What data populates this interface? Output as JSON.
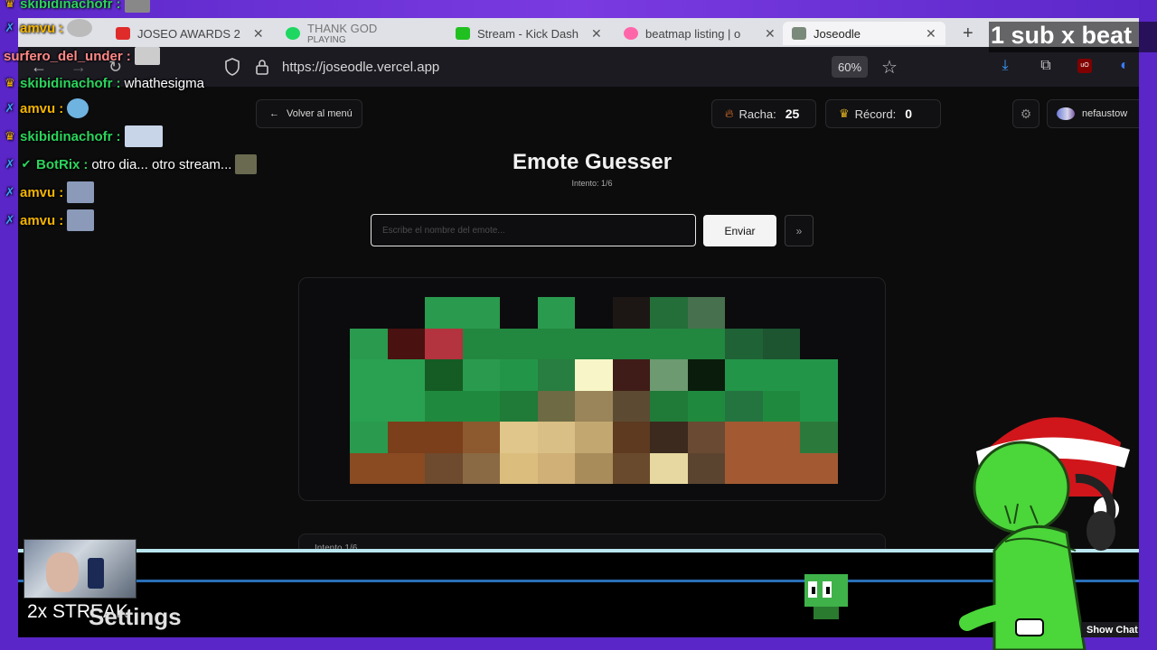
{
  "tabs": [
    {
      "title": "JOSEO AWARDS 2",
      "favicon_color": "#e02b2b",
      "has_close": true
    },
    {
      "title": "THANK GOD",
      "subtitle": "PLAYING",
      "favicon_color": "#1ed760",
      "has_close": false
    },
    {
      "title": "Stream - Kick Dash",
      "favicon_color": "#21c021",
      "has_close": true
    },
    {
      "title": "beatmap listing | o",
      "favicon_color": "#ff66aa",
      "has_close": true
    },
    {
      "title": "Joseodle",
      "favicon_color": "#7a8a7a",
      "has_close": true,
      "active": true
    }
  ],
  "new_tab_label": "+",
  "address": {
    "url": "https://joseodle.vercel.app",
    "zoom": "60%"
  },
  "toolbar_icons": [
    "download-icon",
    "extensions-icon",
    "ublock-icon",
    "profile-icon"
  ],
  "app": {
    "back_label": "Volver al menú",
    "streak_label": "Racha:",
    "streak_value": "25",
    "record_label": "Récord:",
    "record_value": "0",
    "username": "nefaustow",
    "title": "Emote Guesser",
    "attempt_text": "Intento: 1/6",
    "input_placeholder": "Escribe el nombre del emote...",
    "input_value": "",
    "send_label": "Enviar",
    "skip_label": "»",
    "history_label": "Intento 1/6"
  },
  "pixel_colors": [
    [
      "#0c0c0e",
      "#0c0c0e",
      "#2a9a4e",
      "#2a9a4e",
      "#0c0c0e",
      "#2a9a4e",
      "#0c0c0e",
      "#1c1715",
      "#246e3a",
      "#47704e",
      "#0c0c0e",
      "#0c0c0e",
      "#0c0c0e"
    ],
    [
      "#2a9a4e",
      "#4a1111",
      "#b3333e",
      "#22873f",
      "#22873f",
      "#22873f",
      "#22873f",
      "#22873f",
      "#22873f",
      "#22873f",
      "#1f6236",
      "#1c5530",
      "#0c0c0e"
    ],
    [
      "#2aa150",
      "#2aa150",
      "#145c23",
      "#2a9a4e",
      "#239548",
      "#277e40",
      "#f8f6c8",
      "#3f1c17",
      "#6d9a70",
      "#0a1c0c",
      "#239548",
      "#239548",
      "#239548"
    ],
    [
      "#2aa150",
      "#2aa150",
      "#1f8a3e",
      "#1f8a3e",
      "#207a38",
      "#6d6a44",
      "#9a845a",
      "#5d4a33",
      "#207a38",
      "#1f8a3e",
      "#247440",
      "#1f8a3e",
      "#239548"
    ],
    [
      "#2a9a4e",
      "#7b3f1b",
      "#7b3f1b",
      "#8c5a2e",
      "#e0c68a",
      "#d9bf85",
      "#c2a870",
      "#5d3a20",
      "#3b2a1d",
      "#6a4a33",
      "#a35a32",
      "#a35a32",
      "#2b7a3c"
    ],
    [
      "#8a4a22",
      "#8a4a22",
      "#6e4a2e",
      "#8a6a44",
      "#dbbe7e",
      "#d0b077",
      "#a88c5a",
      "#6a4a2c",
      "#e6d8a0",
      "#5a4430",
      "#a35a32",
      "#a35a32",
      "#a35a32"
    ]
  ],
  "chat": [
    {
      "badge": "crown",
      "user": "skibidinachofr",
      "color": "#2bd45c",
      "message": ""
    },
    {
      "badge": "sword",
      "user": "amvu",
      "color": "#f4b400",
      "message": ""
    },
    {
      "badge": "",
      "user": "surfero_del_under",
      "color": "#ff8888",
      "message": ""
    },
    {
      "badge": "crown",
      "user": "skibidinachofr",
      "color": "#2bd45c",
      "message": "whathesigma"
    },
    {
      "badge": "sword",
      "user": "amvu",
      "color": "#f4b400",
      "message": ""
    },
    {
      "badge": "crown",
      "user": "skibidinachofr",
      "color": "#2bd45c",
      "message": ""
    },
    {
      "badge": "sword-check",
      "user": "BotRix",
      "color": "#2bd45c",
      "message": "otro dia... otro stream..."
    },
    {
      "badge": "sword",
      "user": "amvu",
      "color": "#f4b400",
      "message": ""
    },
    {
      "badge": "sword",
      "user": "amvu",
      "color": "#f4b400",
      "message": ""
    }
  ],
  "overlay": {
    "sub_goal": "1 sub x beat",
    "streak_text": "2x STREAK",
    "settings_text": "Settings",
    "show_chat": "Show Chat"
  },
  "colors": {
    "frame": "#5a26c8",
    "accent_green": "#2bd45c",
    "page_bg": "#0c0c0d"
  }
}
